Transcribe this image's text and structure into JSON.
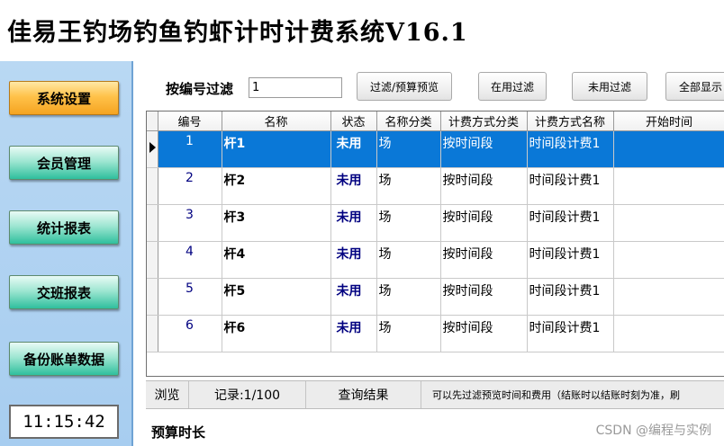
{
  "window": {
    "title": "佳易王钓场钓鱼钓虾计时计费系统V16.1"
  },
  "sidebar": {
    "items": [
      {
        "label": "系统设置"
      },
      {
        "label": "会员管理"
      },
      {
        "label": "统计报表"
      },
      {
        "label": "交班报表"
      },
      {
        "label": "备份账单数据"
      }
    ],
    "clock": "11:15:42"
  },
  "filter": {
    "label": "按编号过滤",
    "value": "1",
    "buttons": {
      "preview": "过滤/预算预览",
      "in_use": "在用过滤",
      "unused": "未用过滤",
      "all": "全部显示"
    }
  },
  "grid": {
    "columns": [
      "编号",
      "名称",
      "状态",
      "名称分类",
      "计费方式分类",
      "计费方式名称",
      "开始时间"
    ],
    "rows": [
      {
        "no": "1",
        "name": "杆1",
        "status": "未用",
        "category": "场",
        "billing_type": "按时间段",
        "billing_name": "时间段计费1",
        "start": ""
      },
      {
        "no": "2",
        "name": "杆2",
        "status": "未用",
        "category": "场",
        "billing_type": "按时间段",
        "billing_name": "时间段计费1",
        "start": ""
      },
      {
        "no": "3",
        "name": "杆3",
        "status": "未用",
        "category": "场",
        "billing_type": "按时间段",
        "billing_name": "时间段计费1",
        "start": ""
      },
      {
        "no": "4",
        "name": "杆4",
        "status": "未用",
        "category": "场",
        "billing_type": "按时间段",
        "billing_name": "时间段计费1",
        "start": ""
      },
      {
        "no": "5",
        "name": "杆5",
        "status": "未用",
        "category": "场",
        "billing_type": "按时间段",
        "billing_name": "时间段计费1",
        "start": ""
      },
      {
        "no": "6",
        "name": "杆6",
        "status": "未用",
        "category": "场",
        "billing_type": "按时间段",
        "billing_name": "时间段计费1",
        "start": ""
      }
    ]
  },
  "statusbar": {
    "browse": "浏览",
    "records": "记录:1/100",
    "query_result": "查询结果",
    "note": "可以先过滤预览时间和费用（结账时以结账时刻为准，刷"
  },
  "bottom": {
    "estimate_label": "预算时长"
  },
  "watermark": "CSDN @编程与实例"
}
